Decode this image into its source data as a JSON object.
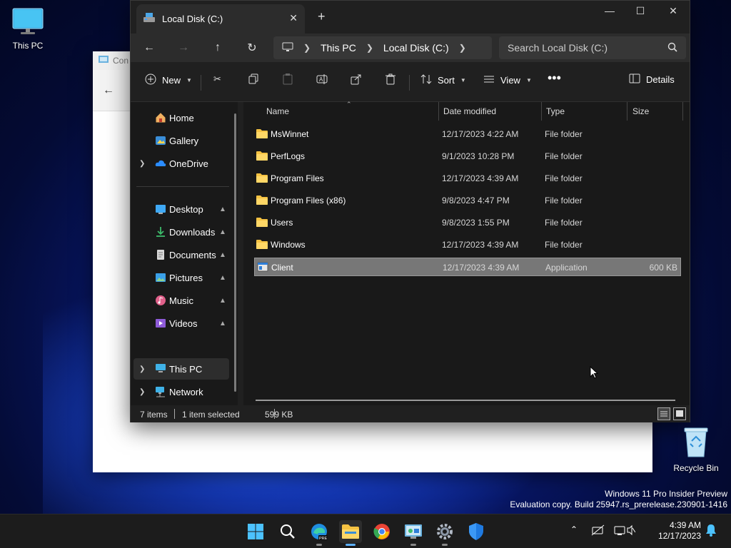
{
  "desktop": {
    "this_pc_label": "This PC",
    "recycle_bin_label": "Recycle Bin",
    "watermark_line1": "Windows 11 Pro Insider Preview",
    "watermark_line2": "Evaluation copy. Build 25947.rs_prerelease.230901-1416"
  },
  "background_window": {
    "title": "Con"
  },
  "explorer": {
    "tab_title": "Local Disk (C:)",
    "breadcrumb": [
      "This PC",
      "Local Disk (C:)"
    ],
    "search_placeholder": "Search Local Disk (C:)",
    "commands": {
      "new": "New",
      "sort": "Sort",
      "view": "View",
      "details": "Details"
    },
    "nav": {
      "home": "Home",
      "gallery": "Gallery",
      "onedrive": "OneDrive",
      "desktop": "Desktop",
      "downloads": "Downloads",
      "documents": "Documents",
      "pictures": "Pictures",
      "music": "Music",
      "videos": "Videos",
      "this_pc": "This PC",
      "network": "Network"
    },
    "columns": {
      "name": "Name",
      "date": "Date modified",
      "type": "Type",
      "size": "Size"
    },
    "files": [
      {
        "name": "MsWinnet",
        "date": "12/17/2023 4:22 AM",
        "type": "File folder",
        "size": ""
      },
      {
        "name": "PerfLogs",
        "date": "9/1/2023 10:28 PM",
        "type": "File folder",
        "size": ""
      },
      {
        "name": "Program Files",
        "date": "12/17/2023 4:39 AM",
        "type": "File folder",
        "size": ""
      },
      {
        "name": "Program Files (x86)",
        "date": "9/8/2023 4:47 PM",
        "type": "File folder",
        "size": ""
      },
      {
        "name": "Users",
        "date": "9/8/2023 1:55 PM",
        "type": "File folder",
        "size": ""
      },
      {
        "name": "Windows",
        "date": "12/17/2023 4:39 AM",
        "type": "File folder",
        "size": ""
      },
      {
        "name": "Client",
        "date": "12/17/2023 4:39 AM",
        "type": "Application",
        "size": "600 KB"
      }
    ],
    "status": {
      "count": "7 items",
      "selected": "1 item selected",
      "selected_size": "599 KB"
    }
  },
  "taskbar": {
    "time": "4:39 AM",
    "date": "12/17/2023"
  }
}
